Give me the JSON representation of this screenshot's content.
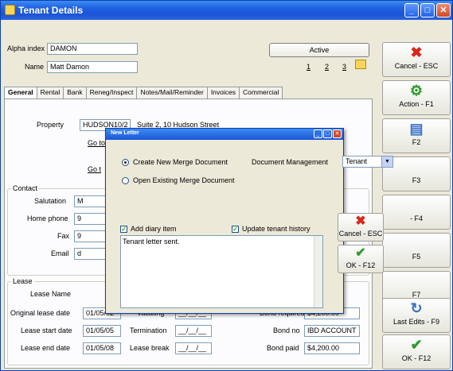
{
  "window": {
    "title": "Tenant Details"
  },
  "top": {
    "alpha_label": "Alpha index",
    "alpha_value": "DAMON",
    "name_label": "Name",
    "name_value": "Matt Damon",
    "active_label": "Active",
    "page_tabs": [
      "1",
      "2",
      "3"
    ]
  },
  "tabs": [
    "General",
    "Rental",
    "Bank",
    "Reneg/Inspect",
    "Notes/Mail/Reminder",
    "Invoices",
    "Commercial"
  ],
  "property": {
    "label": "Property",
    "value": "HUDSON10/2",
    "address": "Suite 2, 10 Hudson Street",
    "goto1": "Go to",
    "goto2": "Go t"
  },
  "contact": {
    "group": "Contact",
    "salutation_label": "Salutation",
    "salutation_value": "M",
    "home_label": "Home phone",
    "home_value": "9",
    "fax_label": "Fax",
    "fax_value": "9",
    "email_label": "Email",
    "email_value": "d"
  },
  "lease": {
    "group": "Lease",
    "name_label": "Lease Name",
    "orig_label": "Original lease date",
    "orig_value": "01/05/02",
    "start_label": "Lease start date",
    "start_value": "01/05/05",
    "end_label": "Lease end date",
    "end_value": "01/05/08",
    "vacating_label": "Vacating",
    "termination_label": "Termination",
    "break_label": "Lease break",
    "blank_date": "__/__/__",
    "bond_req_label": "Bond required",
    "bond_req_value": "$4,200.00",
    "bond_no_label": "Bond no",
    "bond_no_value": "IBD ACCOUNT",
    "bond_paid_label": "Bond paid",
    "bond_paid_value": "$4,200.00"
  },
  "side_buttons": [
    {
      "label": "Cancel - ESC",
      "icon": "cancel-x-icon"
    },
    {
      "label": "Action - F1",
      "icon": "action-icon"
    },
    {
      "label": "F2",
      "icon": "document-icon"
    },
    {
      "label": "F3",
      "icon": ""
    },
    {
      "label": "- F4",
      "icon": ""
    },
    {
      "label": "F5",
      "icon": ""
    },
    {
      "label": "F7",
      "icon": ""
    },
    {
      "label": "Last Edits - F9",
      "icon": "last-edits-icon"
    },
    {
      "label": "OK - F12",
      "icon": "ok-check-icon"
    }
  ],
  "modal": {
    "title": "New Letter",
    "create_label": "Create New Merge Document",
    "open_label": "Open Existing Merge Document",
    "docmgmt_label": "Document Management",
    "docmgmt_value": "Tenant",
    "diary_label": "Add diary item",
    "history_label": "Update tenant history",
    "note_text": "Tenant letter sent.",
    "cancel_label": "Cancel - ESC",
    "ok_label": "OK - F12"
  },
  "colors": {
    "cancel_red": "#d9261c",
    "ok_green": "#2a9a2a",
    "titlebar_blue": "#1f5fe0"
  }
}
